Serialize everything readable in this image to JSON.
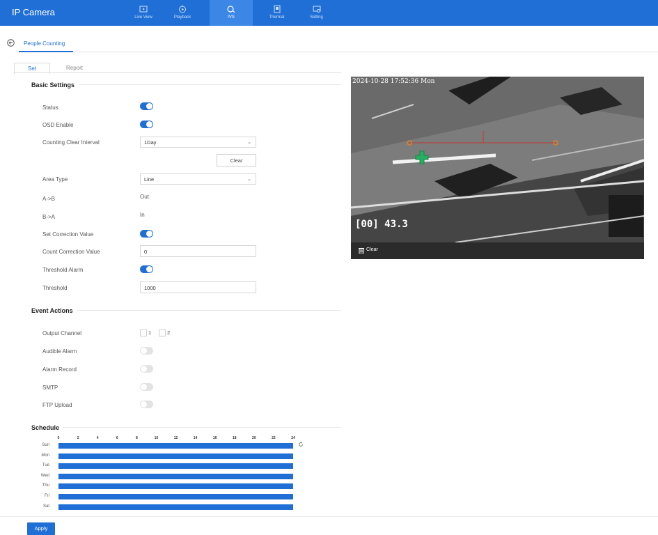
{
  "app": {
    "title": "IP Camera"
  },
  "nav": [
    {
      "label": "Live View",
      "icon": "live-view-icon",
      "active": false
    },
    {
      "label": "Playback",
      "icon": "playback-icon",
      "active": false
    },
    {
      "label": "IVS",
      "icon": "ivs-icon",
      "active": true
    },
    {
      "label": "Thermal",
      "icon": "thermal-icon",
      "active": false
    },
    {
      "label": "Setting",
      "icon": "setting-icon",
      "active": false
    }
  ],
  "page_tab": "People Counting",
  "subtabs": {
    "set": "Set",
    "report": "Report"
  },
  "basic": {
    "title": "Basic Settings",
    "status_label": "Status",
    "osd_label": "OSD Enable",
    "interval_label": "Counting Clear Interval",
    "interval_value": "1Day",
    "clear_button": "Clear",
    "area_label": "Area Type",
    "area_value": "Line",
    "ab_label": "A->B",
    "ab_value": "Out",
    "ba_label": "B->A",
    "ba_value": "In",
    "correction_label": "Set Correction Value",
    "count_correction_label": "Count Correction Value",
    "count_correction_value": "0",
    "threshold_alarm_label": "Threshold Alarm",
    "threshold_label": "Threshold",
    "threshold_value": "1000"
  },
  "toggles": {
    "status": true,
    "osd": true,
    "correction": true,
    "threshold_alarm": true,
    "audible": false,
    "record": false,
    "smtp": false,
    "ftp": false
  },
  "events": {
    "title": "Event Actions",
    "output_label": "Output Channel",
    "channels": [
      "1",
      "2"
    ],
    "audible_label": "Audible Alarm",
    "record_label": "Alarm Record",
    "smtp_label": "SMTP",
    "ftp_label": "FTP Upload"
  },
  "schedule": {
    "title": "Schedule",
    "hours": [
      "0",
      "2",
      "4",
      "6",
      "8",
      "10",
      "12",
      "14",
      "16",
      "18",
      "20",
      "22",
      "24"
    ],
    "days": [
      "Sun",
      "Mon",
      "Tue",
      "Wed",
      "Thu",
      "Fri",
      "Sat"
    ]
  },
  "video": {
    "timestamp": "2024-10-28 17:52:36 Mon",
    "temperature": "[00] 43.3",
    "clear_label": "Clear"
  },
  "apply_label": "Apply",
  "colors": {
    "accent": "#1f6fd6",
    "topbar": "#1f6fd6"
  }
}
